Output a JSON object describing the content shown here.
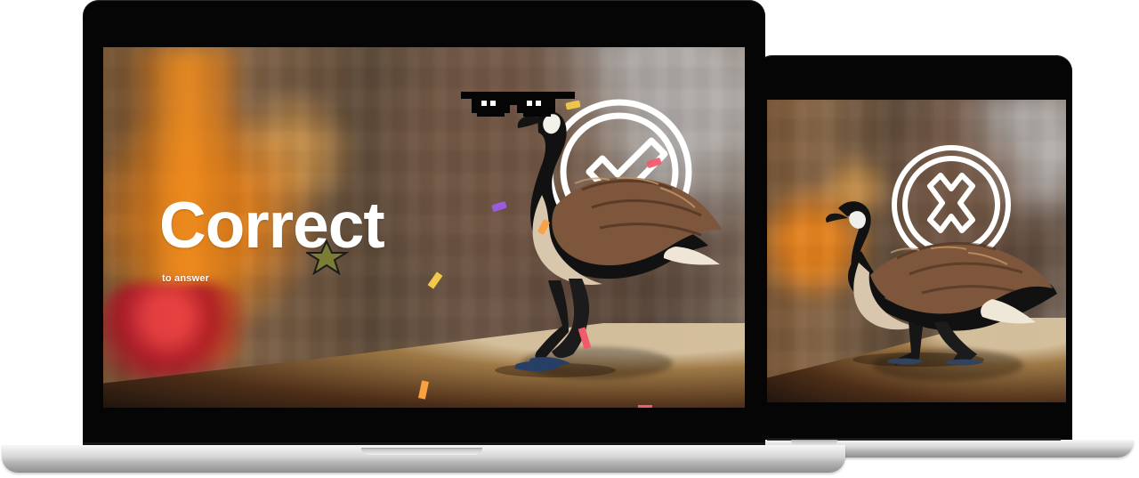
{
  "screens": {
    "correct": {
      "title": "Correct",
      "subtitle": "to answer",
      "icon": "checkmark-circle-icon"
    },
    "incorrect": {
      "icon": "x-circle-icon"
    }
  },
  "colors": {
    "laptop_bezel": "#050505",
    "laptop_base": "#d6d6d6",
    "status_icon": "#ffffff",
    "background_orange": "#e6821c",
    "background_red": "#a91425",
    "goose_black": "#111111",
    "goose_brown": "#7d563b",
    "goose_cream": "#d8c6ad"
  },
  "confetti_colors": [
    "#f2c94c",
    "#9b5de5",
    "#f15b6c",
    "#a7c957",
    "#f9a03f"
  ],
  "decorations": {
    "sunglasses": "pixel-sunglasses-icon",
    "star": "star-icon",
    "confetti": "confetti-icon"
  }
}
